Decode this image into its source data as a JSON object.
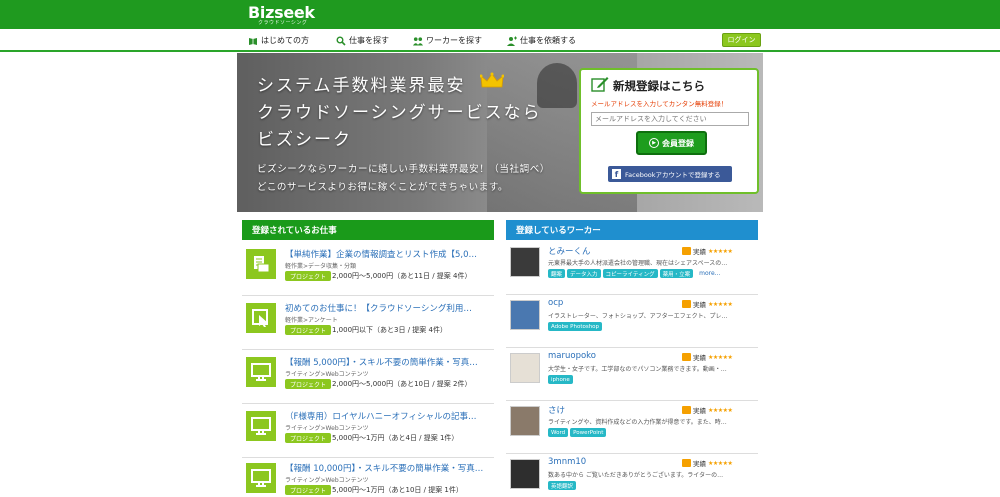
{
  "header": {
    "logo": "Bizseek",
    "logo_sub": "クラウドソーシング",
    "nav": [
      {
        "label": "はじめての方",
        "icon": "book-icon"
      },
      {
        "label": "仕事を探す",
        "icon": "search-icon"
      },
      {
        "label": "ワーカーを探す",
        "icon": "people-icon"
      },
      {
        "label": "仕事を依頼する",
        "icon": "person-plus-icon"
      }
    ],
    "login": "ログイン"
  },
  "hero": {
    "line1": "システム手数料業界最安",
    "line2": "クラウドソーシングサービスなら",
    "line3": "ビズシーク",
    "sub1": "ビズシークならワーカーに嬉しい手数料業界最安！（当社調べ）",
    "sub2": "どこのサービスよりお得に稼ぐことができちゃいます。"
  },
  "register": {
    "title": "新規登録はこちら",
    "note": "メールアドレスを入力してカンタン無料登録！",
    "placeholder": "メールアドレスを入力してください",
    "button": "会員登録",
    "facebook": "Facebookアカウントで登録する"
  },
  "jobs": {
    "heading": "登録されているお仕事",
    "items": [
      {
        "title": "【単純作業】企業の情報調査とリスト作成【5,0…",
        "category": "軽作業>データ収集・分類",
        "tag": "プロジェクト",
        "price": "2,000円〜5,000円（あと11日 / 提案 4件）",
        "icon": "folder-doc-icon"
      },
      {
        "title": "初めてのお仕事に！【クラウドソーシング利用…",
        "category": "軽作業>アンケート",
        "tag": "プロジェクト",
        "price": "1,000円以下（あと3日 / 提案 4件）",
        "icon": "pointer-icon"
      },
      {
        "title": "【報酬 5,000円】・スキル不要の簡単作業・写真…",
        "category": "ライティング>Webコンテンツ",
        "tag": "プロジェクト",
        "price": "2,000円〜5,000円（あと10日 / 提案 2件）",
        "icon": "monitor-icon"
      },
      {
        "title": "（F様専用）ロイヤルハニーオフィシャルの記事…",
        "category": "ライティング>Webコンテンツ",
        "tag": "プロジェクト",
        "price": "5,000円〜1万円（あと4日 / 提案 1件）",
        "icon": "monitor-icon"
      },
      {
        "title": "【報酬 10,000円】・スキル不要の簡単作業・写真…",
        "category": "ライティング>Webコンテンツ",
        "tag": "プロジェクト",
        "price": "5,000円〜1万円（あと10日 / 提案 1件）",
        "icon": "monitor-icon"
      }
    ]
  },
  "workers": {
    "heading": "登録しているワーカー",
    "badge": "実績",
    "stars": "★★★★★",
    "more": "more...",
    "items": [
      {
        "name": "とみーくん",
        "desc": "元東界最大手の人材派遣会社の管理職、現在はシェアスペースの…",
        "tags": [
          "翻案",
          "データ入力",
          "コピーライティング",
          "薬用・立案"
        ],
        "color": "#3a3a3a"
      },
      {
        "name": "ocp",
        "desc": "イラストレーター、フォトショップ、アフターエフェクト、プレ…",
        "tags": [
          "Adobe Photoshop"
        ],
        "color": "#4a78b0"
      },
      {
        "name": "maruopoko",
        "desc": "大学生・女子です。工学部なのでパソコン業務できます。動画・…",
        "tags": [
          "iphone"
        ],
        "color": "#e6e0d6"
      },
      {
        "name": "さけ",
        "desc": "ライティングや、資料作成などの入力作業が得意です。また、時…",
        "tags": [
          "Word",
          "PowerPoint"
        ],
        "color": "#8a7a6a"
      },
      {
        "name": "3mnm10",
        "desc": "数ある中から ご覧いただきありがとうございます。ライターの…",
        "tags": [
          "英語翻訳"
        ],
        "color": "#2e2e2e"
      }
    ]
  }
}
